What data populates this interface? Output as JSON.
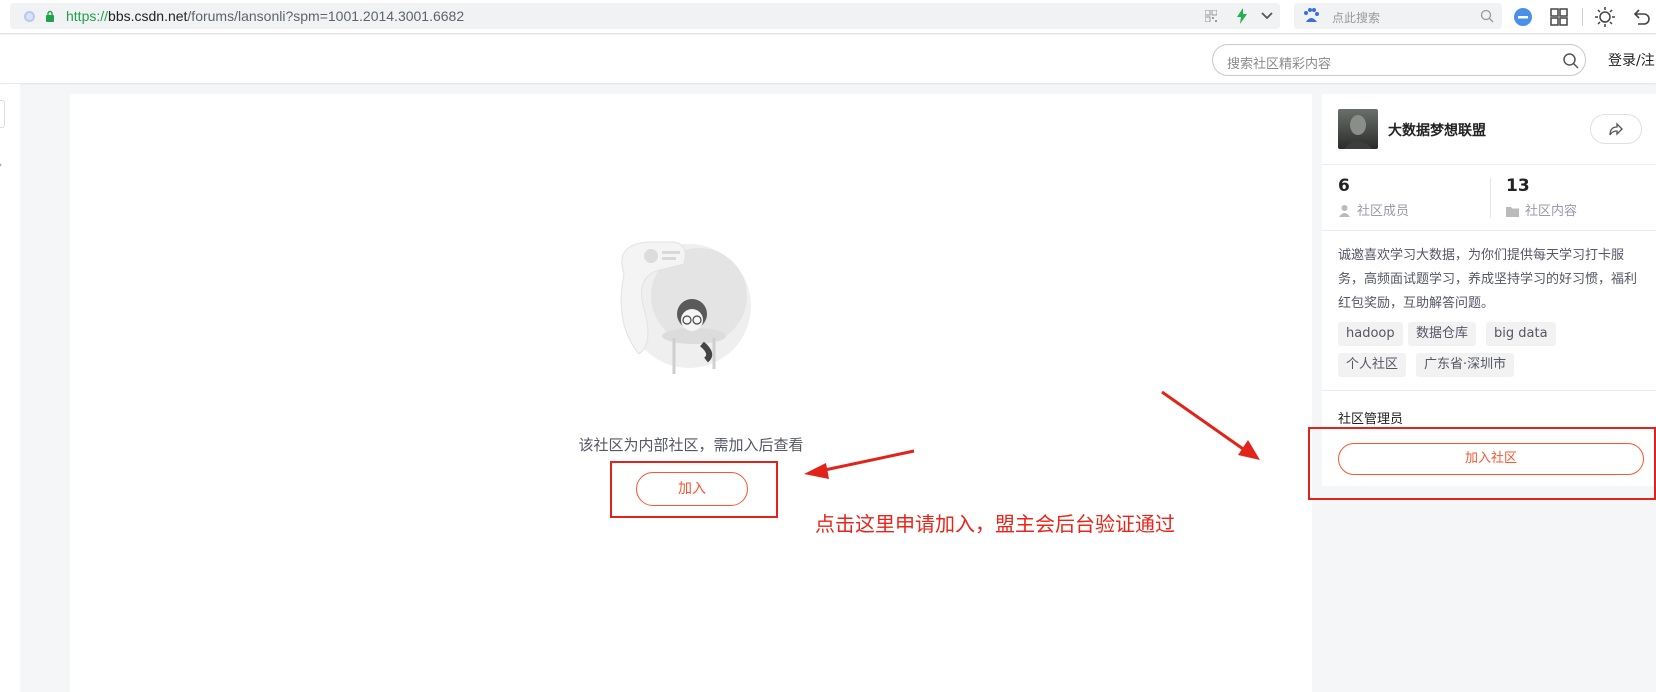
{
  "browser": {
    "url_scheme": "https://",
    "url_host": "bbs.csdn.net",
    "url_path": "/forums/lansonli?spm=1001.2014.3001.6682",
    "search_placeholder": "点此搜索"
  },
  "header": {
    "search_placeholder": "搜索社区精彩内容",
    "login_label": "登录/注"
  },
  "main": {
    "lock_message": "该社区为内部社区，需加入后查看",
    "join_label": "加入"
  },
  "community": {
    "name": "大数据梦想联盟",
    "members_count": "6",
    "members_label": "社区成员",
    "content_count": "13",
    "content_label": "社区内容",
    "description": "诚邀喜欢学习大数据，为你们提供每天学习打卡服务，高频面试题学习，养成坚持学习的好习惯，福利红包奖励，互助解答问题。",
    "tags": [
      "hadoop",
      "数据仓库",
      "big data",
      "个人社区",
      "广东省·深圳市"
    ],
    "admin_title": "社区管理员",
    "join_label": "加入社区"
  },
  "annotation": {
    "text": "点击这里申请加入，盟主会后台验证通过",
    "color": "#e8251a"
  },
  "colors": {
    "accent": "#fc5531",
    "annotation_red": "#e2231a"
  }
}
